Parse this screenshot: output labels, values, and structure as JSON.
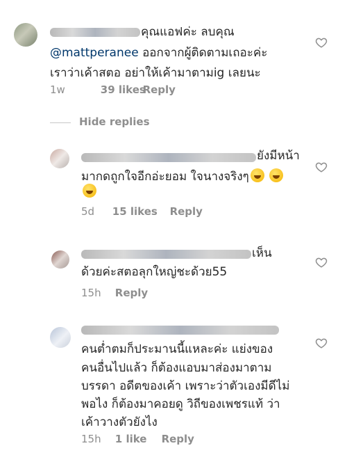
{
  "comments": [
    {
      "line1_suffix": " คุณแอฟค่ะ ลบคุณ",
      "mention": "@mattperanee",
      "line2_suffix": " ออกจากผู้ติดตามเถอะค่ะ",
      "line3": "เราว่าเค้าสตอ อย่าให้เค้ามาตามig เลยนะ",
      "time": "1w",
      "likes": "39 likes",
      "reply": "Reply"
    },
    {
      "line1_suffix": " ยังมีหน้า",
      "line2": "มากดถูกใจอีกอ่ะยอม ใจนางจริงๆ",
      "time": "5d",
      "likes": "15 likes",
      "reply": "Reply"
    },
    {
      "line1_suffix": " เห็น",
      "line2": "ด้วยค่ะสตอลุกใหญ่ชะด้วย55",
      "time": "15h",
      "reply": "Reply"
    },
    {
      "line2": "คนต่ำตมก็ประมานนี้แหละค่ะ แย่งของ",
      "line3": "คนอื่นไปแล้ว ก็ต้องแอบมาส่องมาตาม",
      "line4": "บรรดา อดีตของเค้า เพราะว่าตัวเองมีดีไม่",
      "line5": "พอไง ก็ต้องมาคอยดู วิถีของเพชรแท้ ว่า",
      "line6": "เค้าวางตัวยังไง",
      "time": "15h",
      "likes": "1 like",
      "reply": "Reply"
    }
  ],
  "hide_replies": "Hide replies",
  "icons": {
    "like": "heart-outline-icon",
    "emoji": "rolling-laughing-emoji"
  },
  "colors": {
    "text": "#262626",
    "meta": "#8e8e8e",
    "mention": "#00376b"
  }
}
